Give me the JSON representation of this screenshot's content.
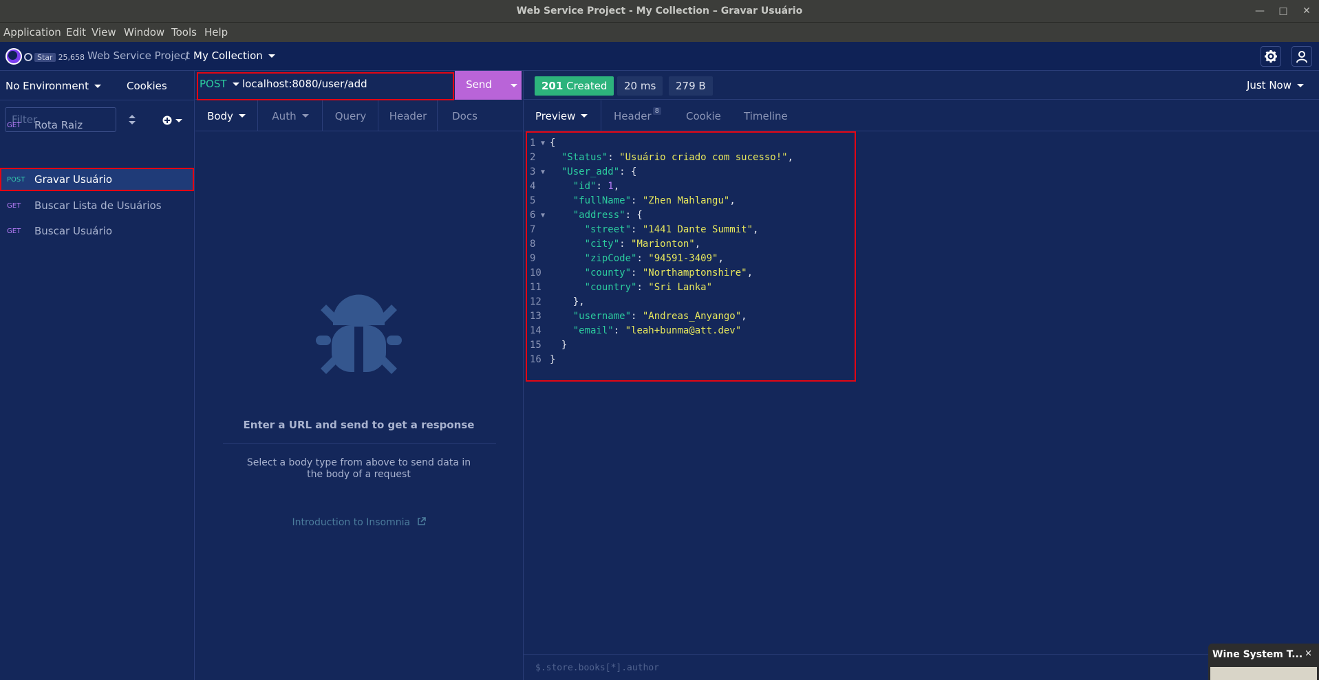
{
  "window": {
    "title": "Web Service Project - My Collection – Gravar Usuário",
    "controls": [
      "minimize-icon",
      "maximize-icon",
      "close-icon"
    ]
  },
  "menu": [
    "Application",
    "Edit",
    "View",
    "Window",
    "Tools",
    "Help"
  ],
  "appbar": {
    "github_star_label": "Star",
    "github_star_count": "25,658",
    "breadcrumb_project": "Web Service Project",
    "breadcrumb_separator": "/",
    "breadcrumb_collection": "My Collection"
  },
  "sidebar": {
    "environment": "No Environment",
    "cookies": "Cookies",
    "filter_placeholder": "Filter",
    "requests": [
      {
        "method": "GET",
        "name": "Rota Raiz",
        "active": false
      },
      {
        "method": "POST",
        "name": "Gravar Usuário",
        "active": true
      },
      {
        "method": "GET",
        "name": "Buscar Lista de Usuários",
        "active": false
      },
      {
        "method": "GET",
        "name": "Buscar Usuário",
        "active": false
      }
    ]
  },
  "request": {
    "method": "POST",
    "url": "localhost:8080/user/add",
    "send_label": "Send",
    "tabs": [
      "Body",
      "Auth",
      "Query",
      "Header",
      "Docs"
    ],
    "empty_title": "Enter a URL and send to get a response",
    "empty_desc": "Select a body type from above to send data in the body of a request",
    "intro_link": "Introduction to Insomnia"
  },
  "response": {
    "status_code": "201",
    "status_text": "Created",
    "time": "20 ms",
    "size": "279 B",
    "history": "Just Now",
    "tabs": {
      "preview": "Preview",
      "header": "Header",
      "header_count": "8",
      "cookie": "Cookie",
      "timeline": "Timeline"
    },
    "json_lines": [
      "{",
      "  \"Status\": \"Usuário criado com sucesso!\",",
      "  \"User_add\": {",
      "    \"id\": 1,",
      "    \"fullName\": \"Zhen Mahlangu\",",
      "    \"address\": {",
      "      \"street\": \"1441 Dante Summit\",",
      "      \"city\": \"Marionton\",",
      "      \"zipCode\": \"94591-3409\",",
      "      \"county\": \"Northamptonshire\",",
      "      \"country\": \"Sri Lanka\"",
      "    },",
      "    \"username\": \"Andreas_Anyango\",",
      "    \"email\": \"leah+bunma@att.dev\"",
      "  }",
      "}"
    ],
    "fold_lines": [
      1,
      3,
      6
    ],
    "jsonpath_placeholder": "$.store.books[*].author"
  },
  "popup": {
    "title": "Wine System T...",
    "close": "×"
  },
  "colors": {
    "background": "#14275a",
    "accent_send": "#b964d8",
    "status_ok": "#2db37c",
    "highlight": "#e30613",
    "json_key": "#2ccb9e",
    "json_string": "#e6e65c",
    "json_number": "#b57cf7",
    "method_get": "#b57cf7",
    "method_post": "#35d2b0"
  }
}
